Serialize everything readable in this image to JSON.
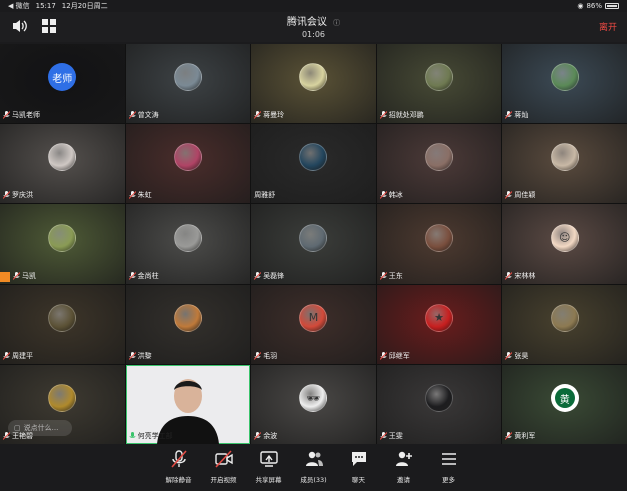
{
  "status": {
    "carrier": "◀ 微信",
    "time": "15:17",
    "date": "12月20日周二",
    "battery": "86%"
  },
  "header": {
    "title": "腾讯会议",
    "timer": "01:06",
    "leave_label": "离开"
  },
  "colors": {
    "leave": "#ee4a43",
    "accent": "#2f6fe6",
    "muted_mic": "#e24b44"
  },
  "participants": [
    {
      "name": "马凯老师",
      "avatar_text": "老师",
      "mic": "muted"
    },
    {
      "name": "曾文涛",
      "mic": "muted"
    },
    {
      "name": "蒋曼玲",
      "mic": "muted"
    },
    {
      "name": "招就处邓鹏",
      "mic": "muted"
    },
    {
      "name": "蒋灿",
      "mic": "muted"
    },
    {
      "name": "罗庆洪",
      "mic": "muted"
    },
    {
      "name": "朱虹",
      "mic": "muted"
    },
    {
      "name": "周雅舒",
      "mic": "none"
    },
    {
      "name": "韩冰",
      "mic": "muted"
    },
    {
      "name": "周佳颖",
      "mic": "muted"
    },
    {
      "name": "马凯",
      "mic": "muted"
    },
    {
      "name": "金尚柱",
      "mic": "muted"
    },
    {
      "name": "吴磊锋",
      "mic": "muted"
    },
    {
      "name": "王东",
      "mic": "muted"
    },
    {
      "name": "宋林林",
      "mic": "muted"
    },
    {
      "name": "周建平",
      "mic": "muted"
    },
    {
      "name": "洪黎",
      "mic": "muted"
    },
    {
      "name": "毛羽",
      "mic": "muted"
    },
    {
      "name": "邱继军",
      "mic": "muted"
    },
    {
      "name": "张昊",
      "mic": "muted"
    },
    {
      "name": "王艳碧",
      "mic": "muted"
    },
    {
      "name": "何亮学工部",
      "mic": "active"
    },
    {
      "name": "余波",
      "mic": "muted"
    },
    {
      "name": "王雯",
      "mic": "muted"
    },
    {
      "name": "黄利军",
      "mic": "muted"
    }
  ],
  "chat_hint": "说点什么...",
  "toolbar": [
    {
      "label": "解除静音",
      "icon": "mic-muted-icon"
    },
    {
      "label": "开启视频",
      "icon": "video-off-icon"
    },
    {
      "label": "共享屏幕",
      "icon": "share-screen-icon"
    },
    {
      "label": "成员(33)",
      "icon": "members-icon"
    },
    {
      "label": "聊天",
      "icon": "chat-icon"
    },
    {
      "label": "邀请",
      "icon": "invite-icon"
    },
    {
      "label": "更多",
      "icon": "more-icon"
    }
  ]
}
